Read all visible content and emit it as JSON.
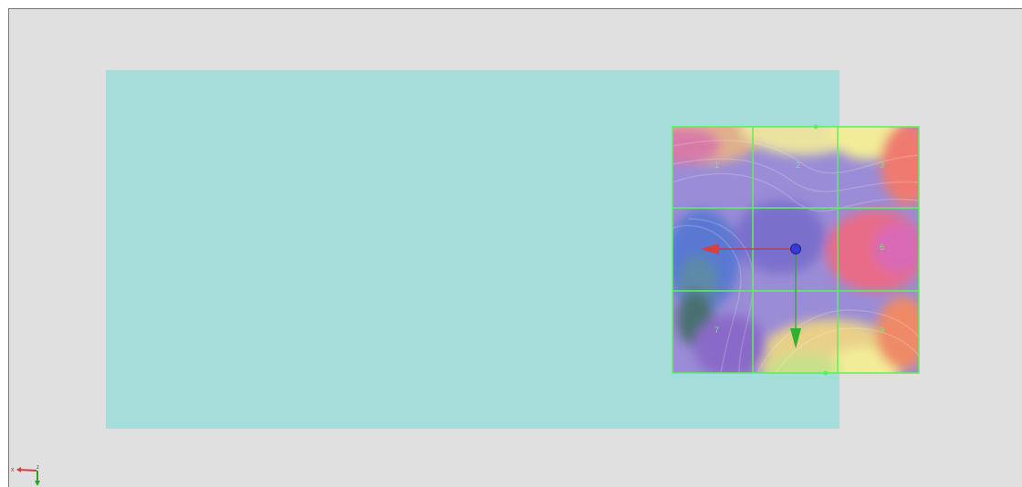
{
  "viewport": {
    "background": "#e0e0e0",
    "plane_color": "#a6dcda"
  },
  "grid": {
    "line_color": "#5df05d",
    "cells": [
      {
        "label": "1"
      },
      {
        "label": "2"
      },
      {
        "label": "3"
      },
      {
        "label": "4"
      },
      {
        "label": "5"
      },
      {
        "label": "6"
      },
      {
        "label": "7"
      },
      {
        "label": "8"
      },
      {
        "label": "9"
      }
    ]
  },
  "transform_gizmo": {
    "center_color": "#3a3ad8",
    "x_axis_color": "#d84040",
    "y_axis_color": "#30b030"
  },
  "axis_triad": {
    "x_label": "x",
    "z_label": "z",
    "icon": "axis-triad-icon"
  }
}
